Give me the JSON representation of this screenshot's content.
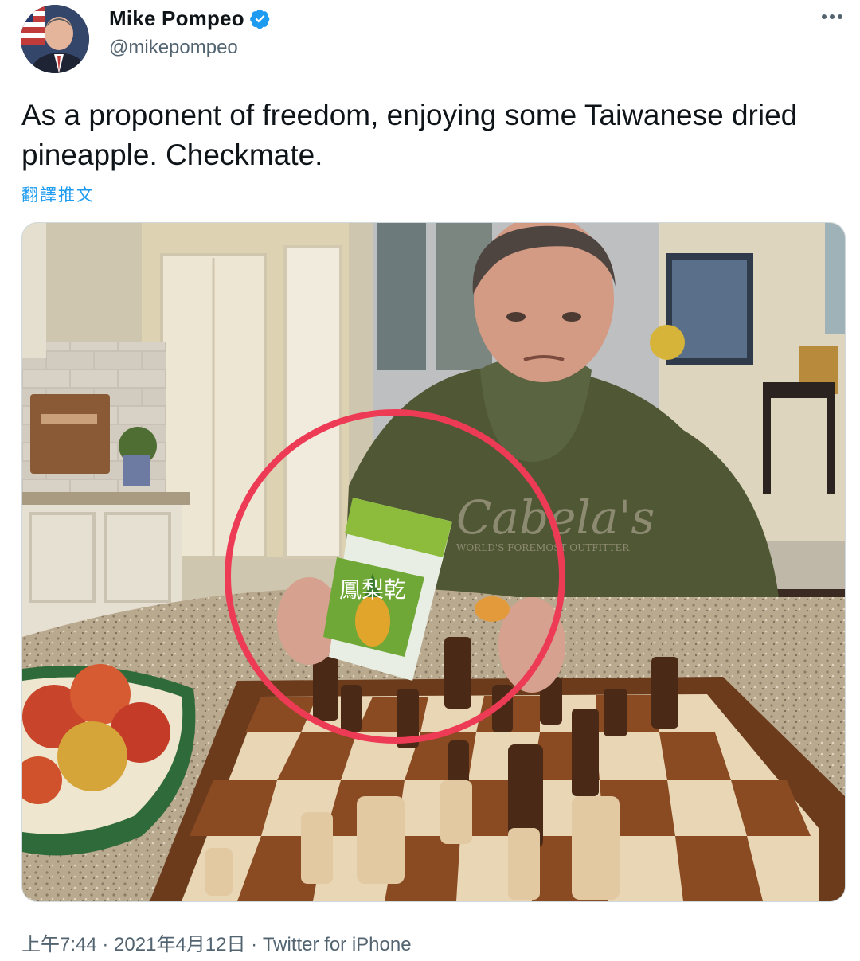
{
  "tweet": {
    "author_name": "Mike Pompeo",
    "author_handle": "@mikepompeo",
    "text": "As a proponent of freedom, enjoying some Taiwanese dried pineapple. Checkmate.",
    "translate_label": "翻譯推文",
    "time": "上午7:44",
    "date": "2021年4月12日",
    "separator": " · ",
    "source": "Twitter for iPhone"
  },
  "photo": {
    "package_text": "鳳梨乾",
    "sweatshirt_text": "Cabela's",
    "sweatshirt_subtext": "WORLD'S FOREMOST OUTFITTER"
  },
  "icons": {
    "verified": "verified-badge-icon",
    "more": "more-dots-icon"
  },
  "colors": {
    "verified": "#1d9bf0",
    "link": "#1d9bf0",
    "secondary_text": "#536471",
    "highlight_circle": "#ee3b55"
  }
}
